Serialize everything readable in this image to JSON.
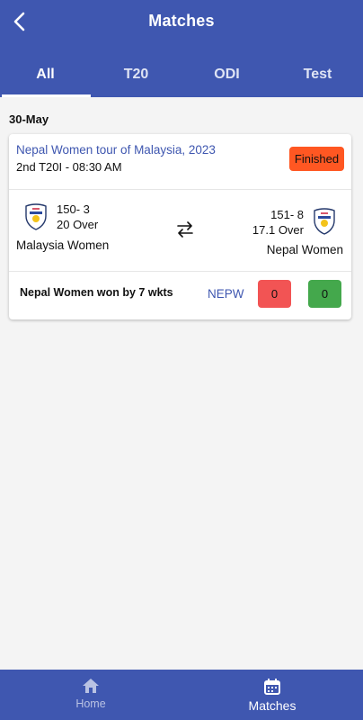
{
  "header": {
    "title": "Matches",
    "back_icon": "arrow-left-icon",
    "tabs": [
      {
        "label": "All",
        "active": true
      },
      {
        "label": "T20",
        "active": false
      },
      {
        "label": "ODI",
        "active": false
      },
      {
        "label": "Test",
        "active": false
      }
    ]
  },
  "date_group": "30-May",
  "match_card": {
    "series": "Nepal Women tour of Malaysia, 2023",
    "match": "2nd T20I - 08:30 AM",
    "status": "Finished",
    "team1": {
      "name": "Malaysia Women",
      "score": "150- 3",
      "overs": "20 Over",
      "logo": "team-crest-icon"
    },
    "team2": {
      "name": "Nepal Women",
      "score": "151- 8",
      "overs": "17.1 Over",
      "logo": "team-crest-icon"
    },
    "swap_icon": "swap-arrows-icon",
    "result": "Nepal Women won by 7 wkts",
    "winner_abbr": "NEPW",
    "vote_left": "0",
    "vote_right": "0"
  },
  "bottom_nav": {
    "items": [
      {
        "label": "Home",
        "icon": "home-icon",
        "active": false
      },
      {
        "label": "Matches",
        "icon": "calendar-icon",
        "active": true
      }
    ]
  },
  "colors": {
    "primary": "#3f57b0",
    "status_finished": "#ff5722",
    "vote_red": "#f25454",
    "vote_green": "#44a84c"
  }
}
